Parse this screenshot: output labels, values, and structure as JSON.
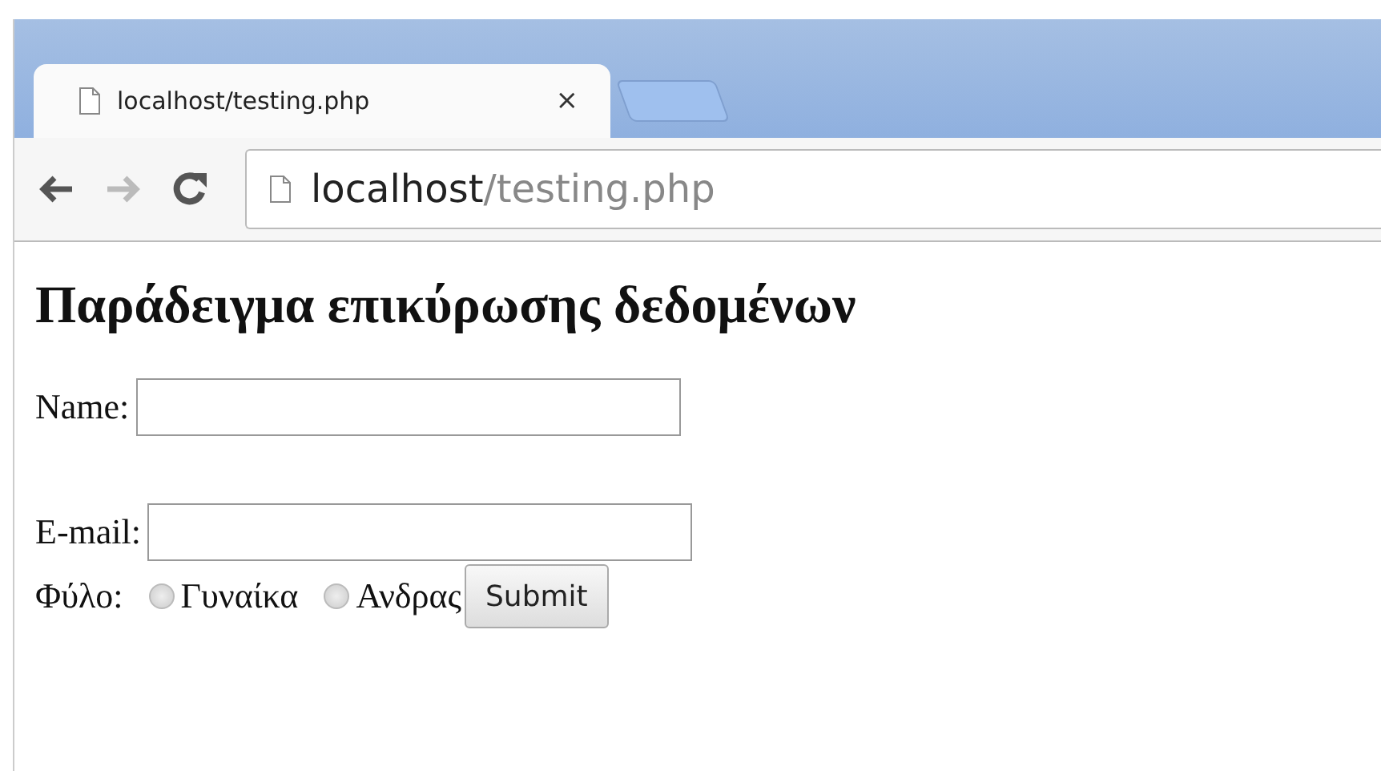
{
  "tab": {
    "title": "localhost/testing.php",
    "close": "×"
  },
  "address_bar": {
    "host": "localhost",
    "path": "/testing.php"
  },
  "heading": "Παράδειγμα επικύρωσης δεδομένων",
  "fields": [
    {
      "label": "Name:"
    },
    {
      "label": "E-mail:"
    }
  ],
  "gender": {
    "label": "Φύλο:",
    "options": [
      {
        "label": "Γυναίκα",
        "selected": false
      },
      {
        "label": "Ανδρας",
        "selected": false
      }
    ]
  },
  "submit": "Submit"
}
